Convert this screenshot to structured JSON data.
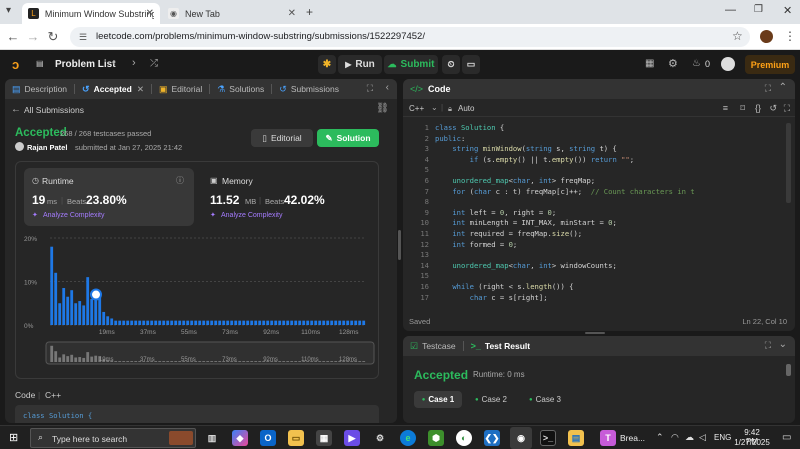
{
  "browser": {
    "tabs": [
      {
        "title": "Minimum Window Substring - L",
        "active": true
      },
      {
        "title": "New Tab",
        "active": false
      }
    ],
    "url": "leetcode.com/problems/minimum-window-substring/submissions/1522297452/"
  },
  "nav": {
    "problem_list": "Problem List",
    "run": "Run",
    "submit": "Submit",
    "streak": "0",
    "premium": "Premium"
  },
  "left_tabs": [
    "Description",
    "Accepted",
    "Editorial",
    "Solutions",
    "Submissions"
  ],
  "submission": {
    "back_label": "All Submissions",
    "status": "Accepted",
    "testcases": "268 / 268 testcases passed",
    "user": "Rajan Patel",
    "submitted": "submitted at Jan 27, 2025 21:42",
    "editorial_btn": "Editorial",
    "solution_btn": "Solution",
    "runtime": {
      "label": "Runtime",
      "value": "19",
      "unit": "ms",
      "beats_label": "Beats",
      "beats": "23.80%",
      "analyze": "Analyze Complexity"
    },
    "memory": {
      "label": "Memory",
      "value": "11.52",
      "unit": "MB",
      "beats_label": "Beats",
      "beats": "42.02%",
      "analyze": "Analyze Complexity"
    },
    "code_label": "Code",
    "code_lang": "C++",
    "code_preview": "class Solution {"
  },
  "chart_data": {
    "type": "bar",
    "y_ticks": [
      "20%",
      "10%",
      "0%"
    ],
    "x_ticks": [
      "19ms",
      "37ms",
      "55ms",
      "73ms",
      "92ms",
      "110ms",
      "128ms"
    ],
    "ylim": [
      0,
      20
    ],
    "values": [
      18,
      12,
      5,
      8.5,
      6.5,
      8,
      5,
      5.5,
      4.5,
      11,
      6,
      7,
      6.5,
      3,
      2,
      1.5,
      1,
      1,
      1,
      1,
      1,
      1,
      1,
      1,
      1,
      1,
      1,
      1,
      1,
      1,
      1,
      1,
      1,
      1,
      1,
      1,
      1,
      1,
      1,
      1,
      1,
      1,
      1,
      1,
      1,
      1,
      1,
      1,
      1,
      1,
      1,
      1,
      1,
      1,
      1,
      1,
      1,
      1,
      1,
      1,
      1,
      1,
      1,
      1,
      1,
      1,
      1,
      1,
      1,
      1,
      1,
      1,
      1,
      1,
      1,
      1,
      1,
      1,
      1
    ],
    "highlight_index": 11,
    "colors": {
      "bar": "#1e78e6",
      "highlight": "#ffffff"
    }
  },
  "editor": {
    "title": "Code",
    "language": "C++",
    "mode": "Auto",
    "status": "Saved",
    "cursor": "Ln 22, Col 10",
    "lines": [
      {
        "n": "1",
        "html": "<span class='kw'>class</span> <span class='ty'>Solution</span> {"
      },
      {
        "n": "2",
        "html": "<span class='kw'>public</span>:"
      },
      {
        "n": "3",
        "html": "    <span class='kw'>string</span> <span class='fn'>minWindow</span>(<span class='kw'>string</span> s, <span class='kw'>string</span> t) {"
      },
      {
        "n": "4",
        "html": "        <span class='kw'>if</span> (s.<span class='fn'>empty</span>() || t.<span class='fn'>empty</span>()) <span class='kw'>return</span> <span class='st'>\"\"</span>;"
      },
      {
        "n": "5",
        "html": ""
      },
      {
        "n": "6",
        "html": "    <span class='ty'>unordered_map</span>&lt;<span class='kw'>char</span>, <span class='kw'>int</span>&gt; freqMap;"
      },
      {
        "n": "7",
        "html": "    <span class='kw'>for</span> (<span class='kw'>char</span> c : t) freqMap[c]++;  <span class='cm'>// Count characters in t</span>"
      },
      {
        "n": "8",
        "html": ""
      },
      {
        "n": "9",
        "html": "    <span class='kw'>int</span> left = <span class='nm'>0</span>, right = <span class='nm'>0</span>;"
      },
      {
        "n": "10",
        "html": "    <span class='kw'>int</span> minLength = INT_MAX, minStart = <span class='nm'>0</span>;"
      },
      {
        "n": "11",
        "html": "    <span class='kw'>int</span> required = freqMap.<span class='fn'>size</span>();"
      },
      {
        "n": "12",
        "html": "    <span class='kw'>int</span> formed = <span class='nm'>0</span>;"
      },
      {
        "n": "13",
        "html": ""
      },
      {
        "n": "14",
        "html": "    <span class='ty'>unordered_map</span>&lt;<span class='kw'>char</span>, <span class='kw'>int</span>&gt; windowCounts;"
      },
      {
        "n": "15",
        "html": ""
      },
      {
        "n": "16",
        "html": "    <span class='kw'>while</span> (right &lt; s.<span class='fn'>length</span>()) {"
      },
      {
        "n": "17",
        "html": "        <span class='kw'>char</span> c = s[right];"
      }
    ]
  },
  "bottom": {
    "testcase_tab": "Testcase",
    "result_tab": "Test Result",
    "status": "Accepted",
    "runtime": "Runtime: 0 ms",
    "cases": [
      "Case 1",
      "Case 2",
      "Case 3"
    ]
  },
  "taskbar": {
    "search_placeholder": "Type here to search",
    "app_label": "Brea...",
    "lang": "ENG",
    "time": "9:42 PM",
    "date": "1/27/2025"
  }
}
